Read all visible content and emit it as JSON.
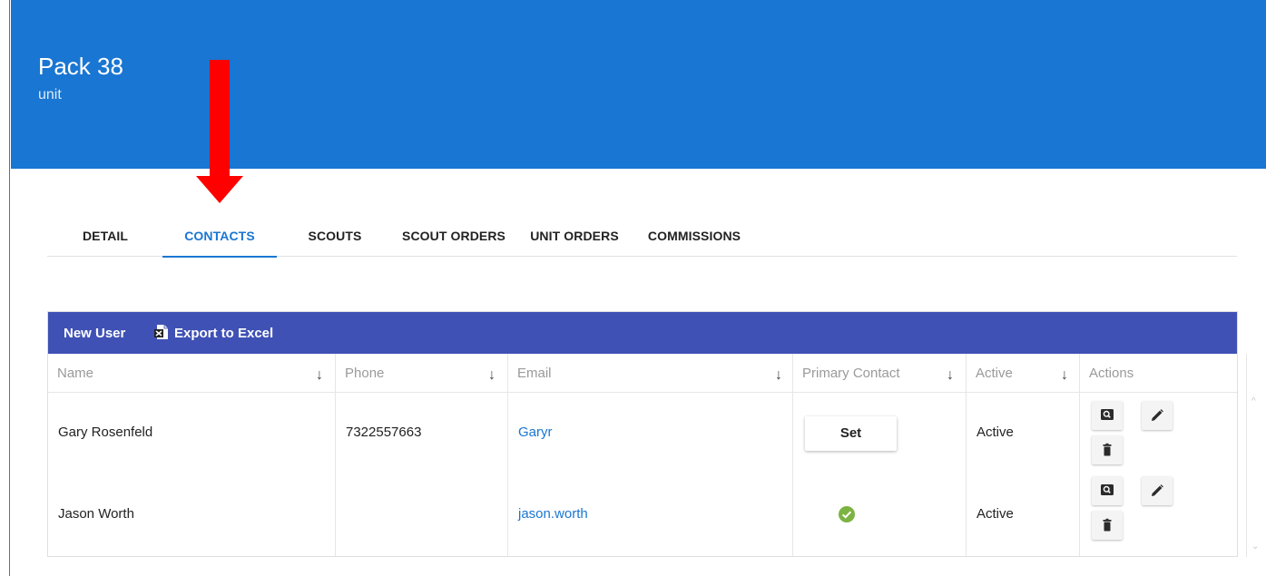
{
  "header": {
    "title": "Pack 38",
    "subtitle": "unit"
  },
  "tabs": [
    {
      "label": "DETAIL"
    },
    {
      "label": "CONTACTS",
      "active": true
    },
    {
      "label": "SCOUTS"
    },
    {
      "label": "SCOUT ORDERS"
    },
    {
      "label": "UNIT ORDERS"
    },
    {
      "label": "COMMISSIONS"
    }
  ],
  "toolbar": {
    "new_user": "New User",
    "export": "Export to Excel"
  },
  "columns": [
    "Name",
    "Phone",
    "Email",
    "Primary Contact",
    "Active",
    "Actions"
  ],
  "sort_glyph": "↓",
  "rows": [
    {
      "name": "Gary Rosenfeld",
      "phone": "7322557663",
      "email": "Garyr",
      "primary_contact": "Set",
      "active": "Active"
    },
    {
      "name": "Jason Worth",
      "phone": "",
      "email": "jason.worth",
      "primary_contact": "check",
      "active": "Active"
    }
  ],
  "icons": {
    "excel": "excel-icon",
    "view": "search-icon",
    "edit": "pencil-icon",
    "delete": "trash-icon",
    "primary": "check-circle-icon",
    "annotation": "red-arrow-down"
  },
  "colors": {
    "header": "#1976d2",
    "toolbar": "#3f51b5",
    "link": "#1976d2",
    "check": "#7cb342",
    "annotation": "#ff0000"
  }
}
